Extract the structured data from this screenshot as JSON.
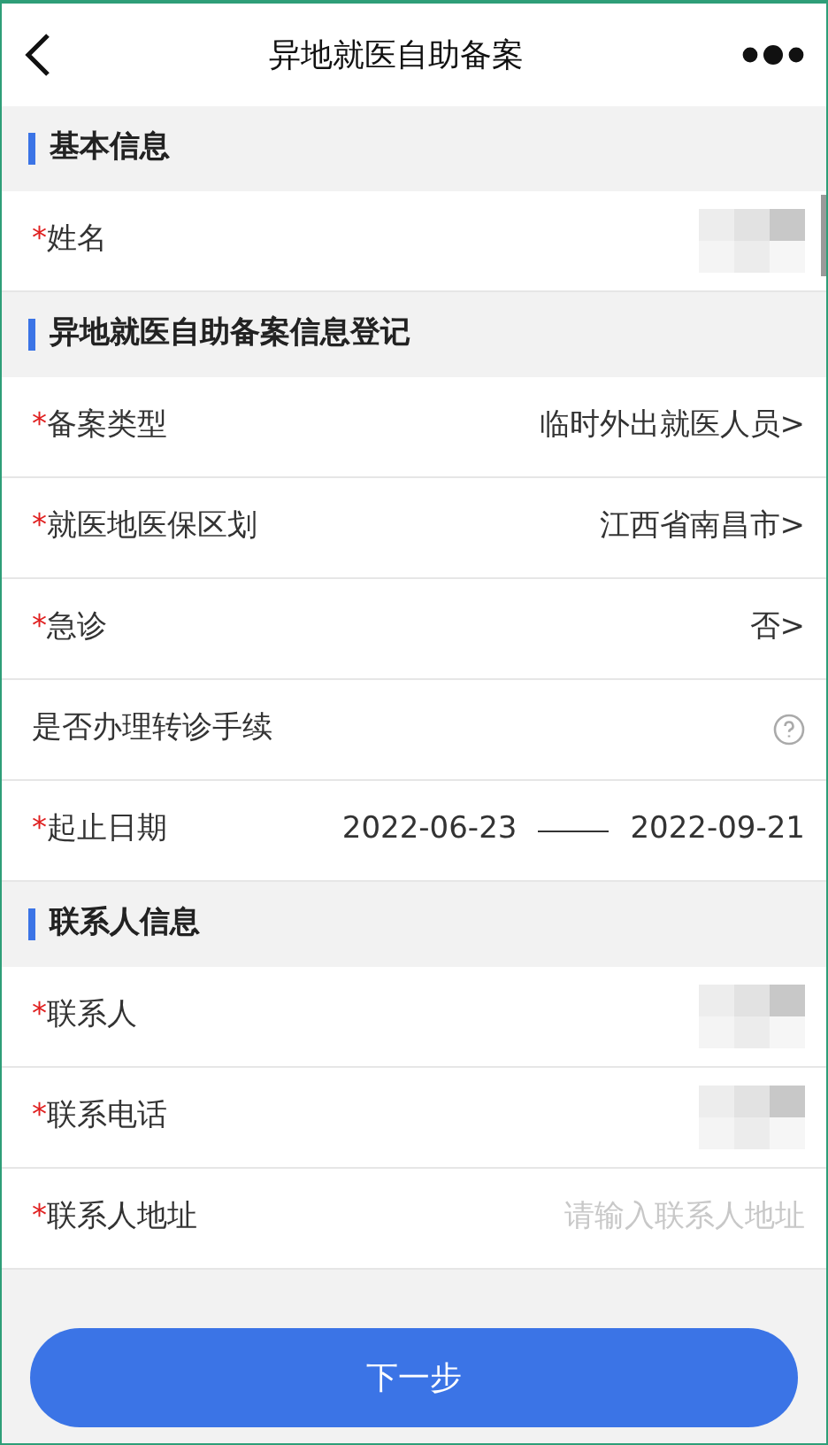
{
  "header": {
    "title": "异地就医自助备案"
  },
  "sections": [
    {
      "title": "基本信息",
      "rows": [
        {
          "kind": "redacted",
          "asterisk": "*",
          "label": "姓名"
        }
      ]
    },
    {
      "title": "异地就医自助备案信息登记",
      "rows": [
        {
          "kind": "select",
          "asterisk": "*",
          "label": "备案类型",
          "value": "临时外出就医人员",
          "chevron": ">"
        },
        {
          "kind": "select",
          "asterisk": "*",
          "label": "就医地医保区划",
          "value": "江西省南昌市",
          "chevron": ">"
        },
        {
          "kind": "select",
          "asterisk": "*",
          "label": "急诊",
          "value": "否",
          "chevron": ">"
        },
        {
          "kind": "help",
          "label": "是否办理转诊手续"
        },
        {
          "kind": "date",
          "asterisk": "*",
          "label": "起止日期",
          "start": "2022-06-23",
          "end": "2022-09-21"
        }
      ]
    },
    {
      "title": "联系人信息",
      "rows": [
        {
          "kind": "redacted",
          "asterisk": "*",
          "label": "联系人"
        },
        {
          "kind": "redacted",
          "asterisk": "*",
          "label": "联系电话"
        },
        {
          "kind": "input",
          "asterisk": "*",
          "label": "联系人地址",
          "placeholder": "请输入联系人地址"
        }
      ]
    }
  ],
  "next_button": "下一步"
}
